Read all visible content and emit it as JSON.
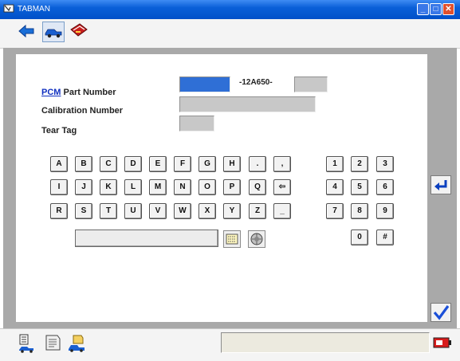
{
  "window": {
    "title": "TABMAN"
  },
  "titlebar_buttons": {
    "minimize": "_",
    "maximize": "□",
    "close": "✕"
  },
  "toolbar": {
    "icons": [
      "back-arrow-icon",
      "vehicle-icon",
      "toolbox-icon"
    ]
  },
  "form": {
    "pcm_link": "PCM",
    "part_number_label": " Part Number",
    "separator": "-12A650-",
    "calibration_label": "Calibration Number",
    "tear_tag_label": "Tear Tag",
    "part_prefix_value": "",
    "part_suffix_value": "",
    "calibration_value": "",
    "tear_tag_value": ""
  },
  "keyboard": {
    "row1": [
      "A",
      "B",
      "C",
      "D",
      "E",
      "F",
      "G",
      "H",
      ".",
      ","
    ],
    "row2": [
      "I",
      "J",
      "K",
      "L",
      "M",
      "N",
      "O",
      "P",
      "Q",
      "⇦"
    ],
    "row3": [
      "R",
      "S",
      "T",
      "U",
      "V",
      "W",
      "X",
      "Y",
      "Z",
      "_"
    ],
    "numpad": [
      "1",
      "2",
      "3",
      "4",
      "5",
      "6",
      "7",
      "8",
      "9",
      "0",
      "#"
    ]
  },
  "status": {
    "text": ""
  },
  "colors": {
    "accent": "#2f6fd6",
    "frame": "#a9a9a9",
    "check": "#1a4fd8"
  }
}
